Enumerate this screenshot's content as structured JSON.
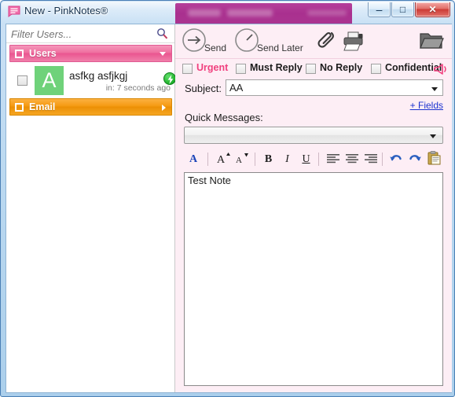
{
  "window": {
    "title": "New - PinkNotes®",
    "icon": "note-icon",
    "controls": {
      "minimize": "–",
      "maximize": "□",
      "close": "✕"
    }
  },
  "sidebar": {
    "filter": {
      "placeholder": "Filter Users...",
      "value": "",
      "icon": "search-icon"
    },
    "groups": [
      {
        "label": "Users",
        "color": "#ea5590",
        "expanded": true,
        "arrow": "chevron-down-icon"
      },
      {
        "label": "Email",
        "color": "#f59a12",
        "expanded": false,
        "arrow": "chevron-right-icon"
      }
    ],
    "users": [
      {
        "initial": "A",
        "avatar_color": "#6fd27a",
        "name": "asfkg asfjkgj",
        "status_text": "in: 7 seconds ago",
        "status_icon": "online-bolt-icon",
        "checked": false
      }
    ]
  },
  "recipient_banner": {
    "redacted": true,
    "color": "#a9308f"
  },
  "toolbar": {
    "send_label": "Send",
    "send_icon": "arrow-right-circle-icon",
    "send_later_label": "Send Later",
    "send_later_icon": "clock-circle-icon",
    "attach_icon": "paperclip-icon",
    "print_icon": "printer-icon",
    "folder_icon": "open-folder-icon"
  },
  "flags": [
    {
      "label": "Urgent",
      "checked": false,
      "color": "#f0407e"
    },
    {
      "label": "Must Reply",
      "checked": false,
      "color": "#1c1c1c"
    },
    {
      "label": "No Reply",
      "checked": false,
      "color": "#1c1c1c"
    },
    {
      "label": "Confidential",
      "checked": false,
      "color": "#1c1c1c"
    }
  ],
  "sound_icon": "speaker-icon",
  "subject": {
    "label": "Subject:",
    "value": "AA",
    "placeholder": ""
  },
  "fields_link": "+ Fields",
  "quick_messages": {
    "label": "Quick Messages:",
    "selected": ""
  },
  "format_toolbar": {
    "buttons": [
      {
        "name": "font-color-icon",
        "glyph": "A",
        "title": "Font Color"
      },
      {
        "name": "increase-font-icon",
        "glyph": "A",
        "title": "Increase Font Size"
      },
      {
        "name": "decrease-font-icon",
        "glyph": "A",
        "title": "Decrease Font Size"
      },
      {
        "name": "bold-icon",
        "glyph": "B",
        "title": "Bold"
      },
      {
        "name": "italic-icon",
        "glyph": "I",
        "title": "Italic"
      },
      {
        "name": "underline-icon",
        "glyph": "U",
        "title": "Underline"
      },
      {
        "name": "align-left-icon",
        "glyph": "",
        "title": "Align Left"
      },
      {
        "name": "align-center-icon",
        "glyph": "",
        "title": "Align Center"
      },
      {
        "name": "align-right-icon",
        "glyph": "",
        "title": "Align Right"
      },
      {
        "name": "undo-icon",
        "glyph": "",
        "title": "Undo"
      },
      {
        "name": "redo-icon",
        "glyph": "",
        "title": "Redo"
      },
      {
        "name": "paste-icon",
        "glyph": "",
        "title": "Paste"
      }
    ]
  },
  "body": {
    "text": "Test Note"
  }
}
